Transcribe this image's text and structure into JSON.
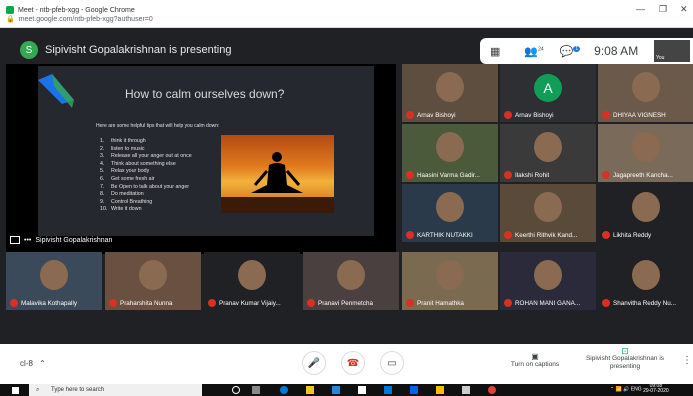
{
  "browser": {
    "title": "Meet - ntb-pfeb-xgg - Google Chrome",
    "url": "meet.google.com/ntb-pfeb-xgg?authuser=0",
    "minimize": "—",
    "restore": "❐",
    "close": "✕"
  },
  "header": {
    "presenter_initial": "S",
    "title": "Sipivisht Gopalakrishnan is presenting",
    "participants_count": "24",
    "chat_badge": "1",
    "time": "9:08 AM",
    "self_label": "You"
  },
  "slide": {
    "title": "How to calm ourselves down?",
    "intro": "Here are some helpful tips that will help you calm down:",
    "tips": [
      {
        "n": "1.",
        "t": "think it through"
      },
      {
        "n": "2.",
        "t": "listen to music"
      },
      {
        "n": "3.",
        "t": "Release all your anger out at once"
      },
      {
        "n": "4.",
        "t": "Think about something else"
      },
      {
        "n": "5.",
        "t": "Relax your body"
      },
      {
        "n": "6.",
        "t": "Get some fresh air"
      },
      {
        "n": "7.",
        "t": "Be Open to talk about your anger"
      },
      {
        "n": "8.",
        "t": "Do meditation"
      },
      {
        "n": "9.",
        "t": "Control Breathing"
      },
      {
        "n": "10.",
        "t": "Write it down"
      }
    ],
    "presenter_name": "Sipivisht Gopalakrishnan"
  },
  "participants": [
    {
      "name": "Arnav Bishoyi"
    },
    {
      "name": "Arnav Bishoyi",
      "initial": "A"
    },
    {
      "name": "DHIYAA VIGNESH"
    },
    {
      "name": "Haasini Varma Gadir..."
    },
    {
      "name": "Ilakshi Rohit"
    },
    {
      "name": "Jagapreeth Kancha..."
    },
    {
      "name": "KARTHIK NUTAKKI"
    },
    {
      "name": "Keerthi Rithvik Kand..."
    },
    {
      "name": "Likhita Reddy"
    },
    {
      "name": "Malavika Kothapally"
    },
    {
      "name": "Praharshita Nunna"
    },
    {
      "name": "Pranav Kumar Vijaiy..."
    },
    {
      "name": "Pranavi Penmetcha"
    },
    {
      "name": "Pranit Hamathka"
    },
    {
      "name": "ROHAN MANI GANA..."
    },
    {
      "name": "Shanvitha Reddy Nu..."
    }
  ],
  "bottom": {
    "meeting_code": "cl-8",
    "captions": "Turn on captions",
    "presenting": "Sipivisht Gopalakrishnan is presenting",
    "more": "⋮"
  },
  "taskbar": {
    "search_placeholder": "Type here to search",
    "lang": "ENG",
    "clock_time": "09:08",
    "clock_date": "29-07-2020"
  }
}
